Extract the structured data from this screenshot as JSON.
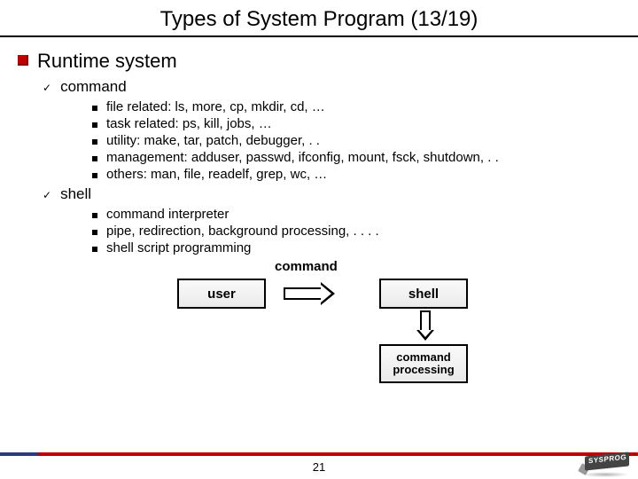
{
  "title": "Types of System Program (13/19)",
  "page_number": "21",
  "l1": {
    "text": "Runtime system"
  },
  "l2": {
    "a": "command",
    "b": "shell"
  },
  "l3a": [
    "file related: ls, more, cp, mkdir, cd, …",
    "task related: ps, kill, jobs, …",
    "utility: make, tar, patch, debugger, . .",
    "management: adduser, passwd, ifconfig, mount, fsck, shutdown, . .",
    "others: man, file, readelf, grep, wc, …"
  ],
  "l3b": [
    "command interpreter",
    "pipe, redirection, background processing, . . . .",
    "shell script programming"
  ],
  "diagram": {
    "cmd_label": "command",
    "user": "user",
    "shell": "shell",
    "cmdproc": "command processing"
  },
  "logo_text": "SYSPROG"
}
